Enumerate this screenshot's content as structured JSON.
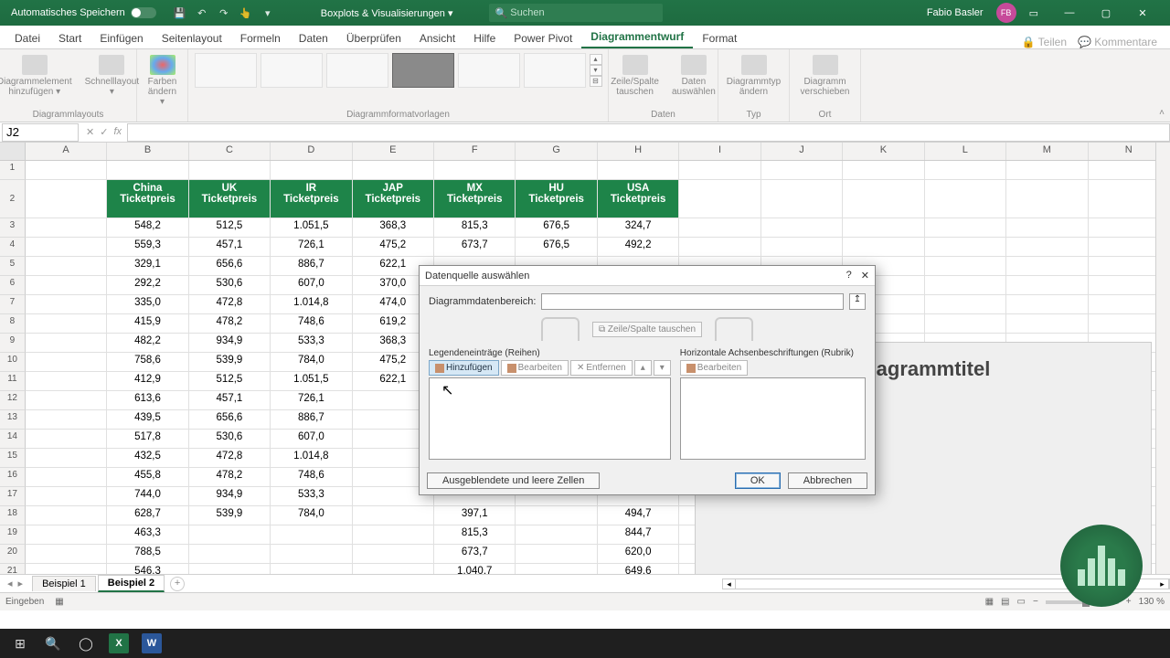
{
  "titlebar": {
    "auto_save": "Automatisches Speichern",
    "app_title": "Boxplots & Visualisierungen ▾",
    "search_placeholder": "Suchen",
    "user_name": "Fabio Basler",
    "user_initials": "FB"
  },
  "tabs": [
    "Datei",
    "Start",
    "Einfügen",
    "Seitenlayout",
    "Formeln",
    "Daten",
    "Überprüfen",
    "Ansicht",
    "Hilfe",
    "Power Pivot",
    "Diagrammentwurf",
    "Format"
  ],
  "active_tab": "Diagrammentwurf",
  "ribbon_right": {
    "share": "Teilen",
    "comments": "Kommentare"
  },
  "ribbon": {
    "groups": {
      "layouts": {
        "btn1": "Diagrammelement hinzufügen ▾",
        "btn2": "Schnelllayout ▾",
        "label": "Diagrammlayouts"
      },
      "colors": {
        "btn": "Farben ändern ▾"
      },
      "styles": {
        "label": "Diagrammformatvorlagen"
      },
      "data": {
        "btn1": "Zeile/Spalte tauschen",
        "btn2": "Daten auswählen",
        "label": "Daten"
      },
      "type": {
        "btn": "Diagrammtyp ändern",
        "label": "Typ"
      },
      "location": {
        "btn": "Diagramm verschieben",
        "label": "Ort"
      }
    }
  },
  "name_box": "J2",
  "columns": [
    "A",
    "B",
    "C",
    "D",
    "E",
    "F",
    "G",
    "H",
    "I",
    "J",
    "K",
    "L",
    "M",
    "N"
  ],
  "headers": [
    {
      "top": "China",
      "bottom": "Ticketpreis"
    },
    {
      "top": "UK",
      "bottom": "Ticketpreis"
    },
    {
      "top": "IR",
      "bottom": "Ticketpreis"
    },
    {
      "top": "JAP",
      "bottom": "Ticketpreis"
    },
    {
      "top": "MX",
      "bottom": "Ticketpreis"
    },
    {
      "top": "HU",
      "bottom": "Ticketpreis"
    },
    {
      "top": "USA",
      "bottom": "Ticketpreis"
    }
  ],
  "rows": [
    {
      "n": 3,
      "v": [
        "548,2",
        "512,5",
        "1.051,5",
        "368,3",
        "815,3",
        "676,5",
        "324,7"
      ]
    },
    {
      "n": 4,
      "v": [
        "559,3",
        "457,1",
        "726,1",
        "475,2",
        "673,7",
        "676,5",
        "492,2"
      ]
    },
    {
      "n": 5,
      "v": [
        "329,1",
        "656,6",
        "886,7",
        "622,1",
        "",
        "",
        ""
      ]
    },
    {
      "n": 6,
      "v": [
        "292,2",
        "530,6",
        "607,0",
        "370,0",
        "",
        "",
        ""
      ]
    },
    {
      "n": 7,
      "v": [
        "335,0",
        "472,8",
        "1.014,8",
        "474,0",
        "",
        "",
        ""
      ]
    },
    {
      "n": 8,
      "v": [
        "415,9",
        "478,2",
        "748,6",
        "619,2",
        "",
        "",
        ""
      ]
    },
    {
      "n": 9,
      "v": [
        "482,2",
        "934,9",
        "533,3",
        "368,3",
        "",
        "",
        ""
      ]
    },
    {
      "n": 10,
      "v": [
        "758,6",
        "539,9",
        "784,0",
        "475,2",
        "",
        "",
        ""
      ]
    },
    {
      "n": 11,
      "v": [
        "412,9",
        "512,5",
        "1.051,5",
        "622,1",
        "",
        "",
        ""
      ]
    },
    {
      "n": 12,
      "v": [
        "613,6",
        "457,1",
        "726,1",
        "",
        "",
        "",
        ""
      ]
    },
    {
      "n": 13,
      "v": [
        "439,5",
        "656,6",
        "886,7",
        "",
        "",
        "",
        ""
      ]
    },
    {
      "n": 14,
      "v": [
        "517,8",
        "530,6",
        "607,0",
        "",
        "",
        "",
        ""
      ]
    },
    {
      "n": 15,
      "v": [
        "432,5",
        "472,8",
        "1.014,8",
        "",
        "",
        "",
        ""
      ]
    },
    {
      "n": 16,
      "v": [
        "455,8",
        "478,2",
        "748,6",
        "",
        "",
        "",
        ""
      ]
    },
    {
      "n": 17,
      "v": [
        "744,0",
        "934,9",
        "533,3",
        "",
        "",
        "",
        ""
      ]
    },
    {
      "n": 18,
      "v": [
        "628,7",
        "539,9",
        "784,0",
        "",
        "397,1",
        "",
        "494,7"
      ]
    },
    {
      "n": 19,
      "v": [
        "463,3",
        "",
        "",
        "",
        "815,3",
        "",
        "844,7"
      ]
    },
    {
      "n": 20,
      "v": [
        "788,5",
        "",
        "",
        "",
        "673,7",
        "",
        "620,0"
      ]
    },
    {
      "n": 21,
      "v": [
        "546,3",
        "",
        "",
        "",
        "1.040,7",
        "",
        "649,6"
      ]
    }
  ],
  "chart": {
    "title": "Diagrammtitel"
  },
  "dialog": {
    "title": "Datenquelle auswählen",
    "range_label": "Diagrammdatenbereich:",
    "switch": "Zeile/Spalte tauschen",
    "legend_label": "Legendeneinträge (Reihen)",
    "axis_label": "Horizontale Achsenbeschriftungen (Rubrik)",
    "add": "Hinzufügen",
    "edit": "Bearbeiten",
    "remove": "Entfernen",
    "edit2": "Bearbeiten",
    "hidden": "Ausgeblendete und leere Zellen",
    "ok": "OK",
    "cancel": "Abbrechen"
  },
  "sheets": [
    "Beispiel 1",
    "Beispiel 2"
  ],
  "active_sheet": "Beispiel 2",
  "status": {
    "mode": "Eingeben",
    "zoom": "130 %"
  },
  "taskbar": {
    "time": ""
  }
}
